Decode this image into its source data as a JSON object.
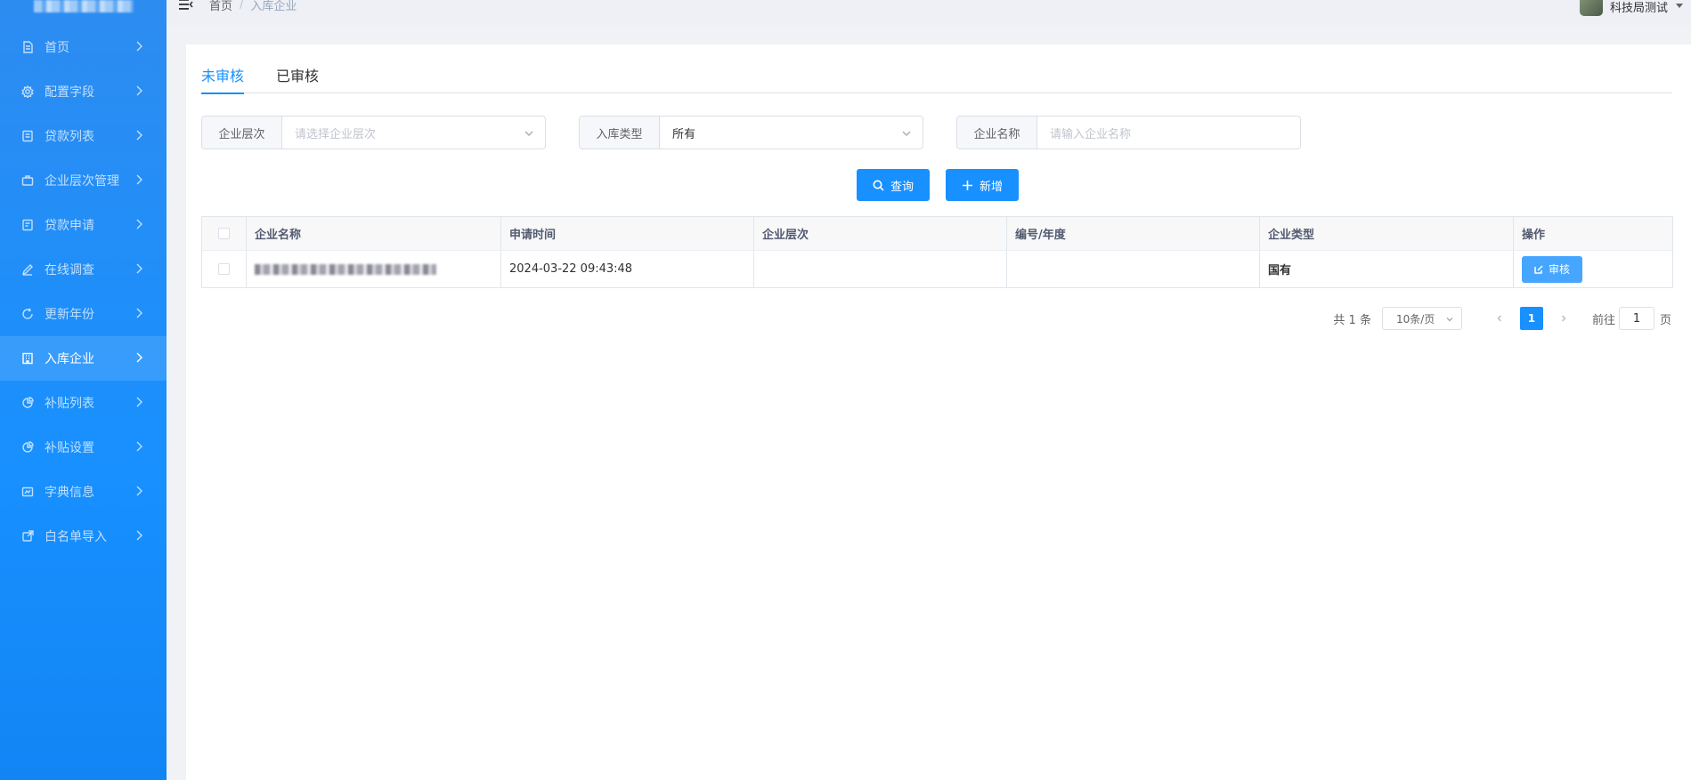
{
  "header": {
    "breadcrumb_home": "首页",
    "breadcrumb_sep": "/",
    "breadcrumb_current": "入库企业",
    "username": "科技局测试"
  },
  "sidebar": {
    "items": [
      {
        "label": "首页",
        "icon": "document-icon"
      },
      {
        "label": "配置字段",
        "icon": "settings-icon"
      },
      {
        "label": "贷款列表",
        "icon": "list-icon"
      },
      {
        "label": "企业层次管理",
        "icon": "briefcase-icon"
      },
      {
        "label": "贷款申请",
        "icon": "form-icon"
      },
      {
        "label": "在线调查",
        "icon": "edit-icon"
      },
      {
        "label": "更新年份",
        "icon": "refresh-icon"
      },
      {
        "label": "入库企业",
        "icon": "building-icon",
        "active": true
      },
      {
        "label": "补贴列表",
        "icon": "pie-icon"
      },
      {
        "label": "补贴设置",
        "icon": "pie-icon"
      },
      {
        "label": "字典信息",
        "icon": "dictionary-icon"
      },
      {
        "label": "白名单导入",
        "icon": "import-icon"
      }
    ]
  },
  "tabs": [
    {
      "label": "未审核",
      "active": true
    },
    {
      "label": "已审核",
      "active": false
    }
  ],
  "filters": {
    "level": {
      "label": "企业层次",
      "placeholder": "请选择企业层次"
    },
    "type": {
      "label": "入库类型",
      "value": "所有"
    },
    "name": {
      "label": "企业名称",
      "placeholder": "请输入企业名称"
    }
  },
  "actions": {
    "search": "查询",
    "add": "新增"
  },
  "table": {
    "headers": [
      "企业名称",
      "申请时间",
      "企业层次",
      "编号/年度",
      "企业类型",
      "操作"
    ],
    "rows": [
      {
        "name": "",
        "time": "2024-03-22 09:43:48",
        "level": "",
        "number": "",
        "type": "国有",
        "action": "审核"
      }
    ]
  },
  "pagination": {
    "total": "共 1 条",
    "page_size": "10条/页",
    "current_page": "1",
    "goto_prefix": "前往",
    "goto_value": "1",
    "goto_suffix": "页"
  },
  "colors": {
    "primary": "#1890ff",
    "sidebar": "#1890ff",
    "audit_button": "#46a6ff"
  }
}
